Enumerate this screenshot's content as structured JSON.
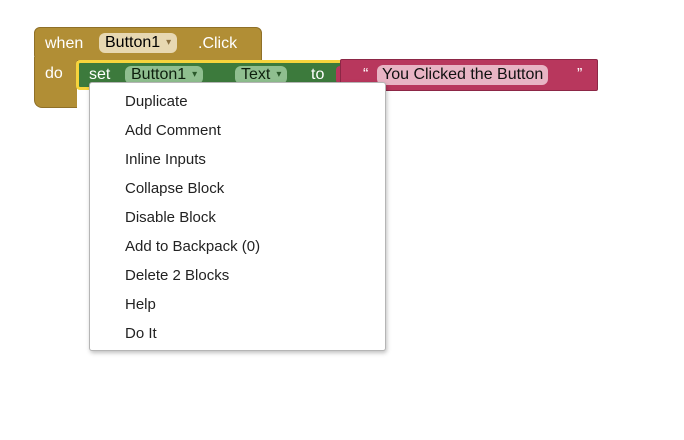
{
  "event_block": {
    "when_label": "when",
    "component": "Button1",
    "event": ".Click",
    "do_label": "do"
  },
  "set_block": {
    "set_label": "set",
    "component": "Button1",
    "property": "Text",
    "to_label": "to"
  },
  "string_block": {
    "open_quote": "“",
    "value": "You Clicked the Button",
    "close_quote": "”"
  },
  "dropdown_arrow": "▾",
  "context_menu": {
    "items": [
      "Duplicate",
      "Add Comment",
      "Inline Inputs",
      "Collapse Block",
      "Disable Block",
      "Add to Backpack (0)",
      "Delete 2 Blocks",
      "Help",
      "Do It"
    ]
  },
  "colors": {
    "event_block": "#b18e35",
    "set_block": "#3c7a3c",
    "string_block": "#b8375d",
    "selection_outline": "#f6d43c"
  }
}
